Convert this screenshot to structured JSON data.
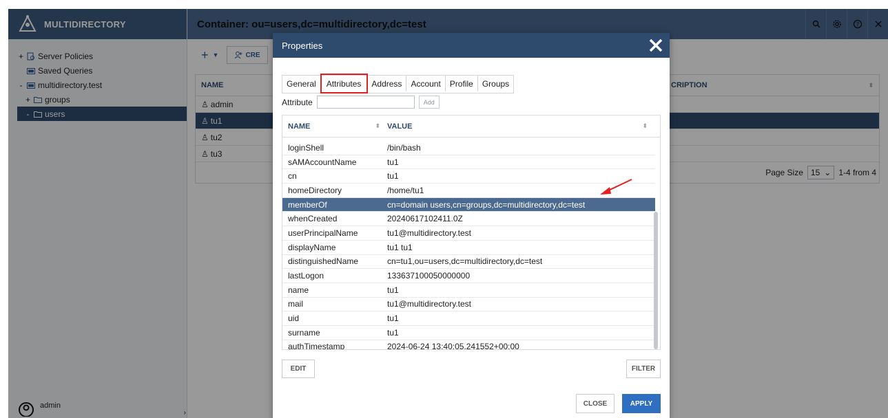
{
  "app": {
    "brand_name": "MULTIDIRECTORY",
    "container_title": "Container: ou=users,dc=multidirectory,dc=test"
  },
  "sidebar": {
    "items": [
      {
        "toggle": "+",
        "label": "Server Policies",
        "icon": "policy-icon"
      },
      {
        "toggle": "",
        "label": "Saved Queries",
        "icon": "folder-icon"
      },
      {
        "toggle": "-",
        "label": "multidirectory.test",
        "icon": "folder-icon"
      },
      {
        "toggle": "+",
        "label": "groups",
        "icon": "folder-icon"
      },
      {
        "toggle": "-",
        "label": "users",
        "icon": "folder-icon"
      }
    ],
    "user_name": "admin"
  },
  "toolbar": {
    "create_label": "CRE"
  },
  "grid": {
    "columns": [
      "NAME",
      "CRIPTION"
    ],
    "rows": [
      "admin",
      "tu1",
      "tu2",
      "tu3"
    ],
    "selected_row": "tu1",
    "page_size_label": "Page Size",
    "page_size_value": "15",
    "range_text": "1-4 from 4"
  },
  "modal": {
    "title": "Properties",
    "tabs": [
      "General",
      "Attributes",
      "Address",
      "Account",
      "Profile",
      "Groups"
    ],
    "active_tab": "Attributes",
    "attribute_label": "Attribute",
    "attribute_value": "",
    "add_label": "Add",
    "columns": {
      "name": "NAME",
      "value": "VALUE"
    },
    "attributes": [
      {
        "name": "loginShell",
        "value": "/bin/bash"
      },
      {
        "name": "sAMAccountName",
        "value": "tu1"
      },
      {
        "name": "cn",
        "value": "tu1"
      },
      {
        "name": "homeDirectory",
        "value": "/home/tu1"
      },
      {
        "name": "memberOf",
        "value": "cn=domain users,cn=groups,dc=multidirectory,dc=test"
      },
      {
        "name": "whenCreated",
        "value": "20240617102411.0Z"
      },
      {
        "name": "userPrincipalName",
        "value": "tu1@multidirectory.test"
      },
      {
        "name": "displayName",
        "value": "tu1 tu1"
      },
      {
        "name": "distinguishedName",
        "value": "cn=tu1,ou=users,dc=multidirectory,dc=test"
      },
      {
        "name": "lastLogon",
        "value": "133637100050000000"
      },
      {
        "name": "name",
        "value": "tu1"
      },
      {
        "name": "mail",
        "value": "tu1@multidirectory.test"
      },
      {
        "name": "uid",
        "value": "tu1"
      },
      {
        "name": "surname",
        "value": "tu1"
      },
      {
        "name": "authTimestamp",
        "value": "2024-06-24 13:40:05.241552+00:00"
      }
    ],
    "selected_attribute": "memberOf",
    "edit_label": "EDIT",
    "filter_label": "FILTER",
    "close_label": "CLOSE",
    "apply_label": "APPLY"
  },
  "colors": {
    "brand": "#3b5a7e",
    "header": "#4a6a92",
    "selection": "#2f4c6e",
    "apply": "#2f6fc2",
    "highlight": "#e52020"
  }
}
